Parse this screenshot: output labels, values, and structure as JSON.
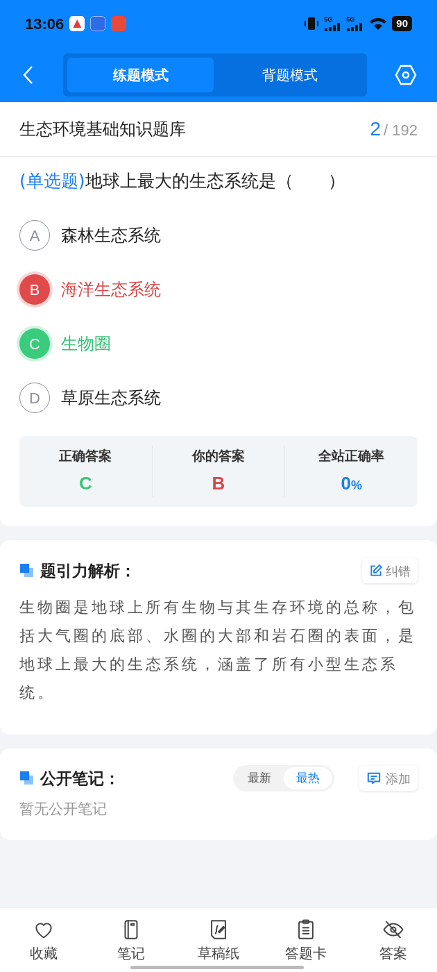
{
  "status_bar": {
    "time": "13:06",
    "signals": [
      "5G",
      "5G"
    ],
    "battery": "90"
  },
  "header": {
    "tabs": [
      {
        "label": "练题模式",
        "selected": true
      },
      {
        "label": "背题模式",
        "selected": false
      }
    ]
  },
  "bank": {
    "title": "生态环境基础知识题库",
    "current": "2",
    "separator": "/",
    "total": "192"
  },
  "question": {
    "type": "(单选题)",
    "text": "地球上最大的生态系统是（　　）",
    "options": [
      {
        "letter": "A",
        "text": "森林生态系统",
        "kind": "plain"
      },
      {
        "letter": "B",
        "text": "海洋生态系统",
        "kind": "wrong"
      },
      {
        "letter": "C",
        "text": "生物圈",
        "kind": "correct"
      },
      {
        "letter": "D",
        "text": "草原生态系统",
        "kind": "plain"
      }
    ]
  },
  "result": [
    {
      "label": "正确答案",
      "value": "C",
      "kind": "correct"
    },
    {
      "label": "你的答案",
      "value": "B",
      "kind": "wrong"
    },
    {
      "label": "全站正确率",
      "value": "0",
      "unit": "%",
      "kind": "rate"
    }
  ],
  "analysis": {
    "title": "题引力解析：",
    "action": "纠错",
    "text": "生物圈是地球上所有生物与其生存环境的总称，包括大气圈的底部、水圈的大部和岩石圈的表面，是地球上最大的生态系统，涵盖了所有小型生态系统。"
  },
  "notes": {
    "title": "公开笔记：",
    "sort": [
      {
        "label": "最新",
        "selected": false
      },
      {
        "label": "最热",
        "selected": true
      }
    ],
    "action": "添加",
    "empty": "暂无公开笔记"
  },
  "bottom_nav": [
    {
      "label": "收藏",
      "kind": "heart"
    },
    {
      "label": "笔记",
      "kind": "notebook"
    },
    {
      "label": "草稿纸",
      "kind": "draft"
    },
    {
      "label": "答题卡",
      "kind": "clipboard"
    },
    {
      "label": "答案",
      "kind": "eye-off"
    }
  ]
}
